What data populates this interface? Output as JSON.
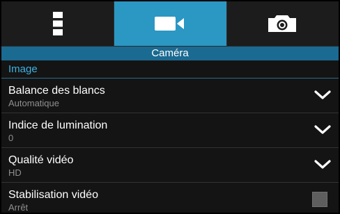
{
  "mode_tabs": [
    {
      "icon": "more-vertical-icon",
      "active": false
    },
    {
      "icon": "video-camera-icon",
      "active": true
    },
    {
      "icon": "camera-icon",
      "active": false
    }
  ],
  "section_title": "Caméra",
  "category": "Image",
  "settings": [
    {
      "title": "Balance des blancs",
      "value": "Automatique",
      "control": "dropdown"
    },
    {
      "title": "Indice de lumination",
      "value": "0",
      "control": "dropdown"
    },
    {
      "title": "Qualité vidéo",
      "value": "HD",
      "control": "dropdown"
    },
    {
      "title": "Stabilisation vidéo",
      "value": "Arrêt",
      "control": "checkbox",
      "checked": false
    }
  ],
  "colors": {
    "accent_active_tab": "#2b97c3",
    "section_bar": "#1b6a91",
    "category_text": "#3fb2e2",
    "background": "#141414"
  }
}
